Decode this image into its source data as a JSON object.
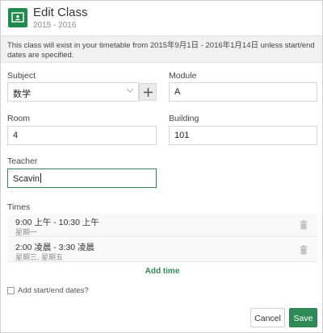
{
  "header": {
    "title": "Edit Class",
    "subtitle": "2015 - 2016"
  },
  "notice": {
    "text": "This class will exist in your timetable from 2015年9月1日 - 2016年1月14日 unless start/end dates are specified."
  },
  "form": {
    "subject": {
      "label": "Subject",
      "value": "数学"
    },
    "module": {
      "label": "Module",
      "value": "A"
    },
    "room": {
      "label": "Room",
      "value": "4"
    },
    "building": {
      "label": "Building",
      "value": "101"
    },
    "teacher": {
      "label": "Teacher",
      "value": "Scavin"
    }
  },
  "times": {
    "label": "Times",
    "items": [
      {
        "time": "9:00 上午 - 10:30 上午",
        "days": "星期一"
      },
      {
        "time": "2:00 凌晨 - 3:30 凌晨",
        "days": "星期三, 星期五"
      }
    ],
    "add_label": "Add time"
  },
  "dates_checkbox": {
    "label": "Add start/end dates?",
    "checked": false
  },
  "buttons": {
    "cancel": "Cancel",
    "save": "Save"
  },
  "colors": {
    "accent": "#2e8b57",
    "logo": "#1f8a4c"
  },
  "icons": {
    "logo": "classroom-icon",
    "subject_dropdown": "chevron-down-icon",
    "add_subject": "plus-icon",
    "delete_time": "trash-icon"
  }
}
